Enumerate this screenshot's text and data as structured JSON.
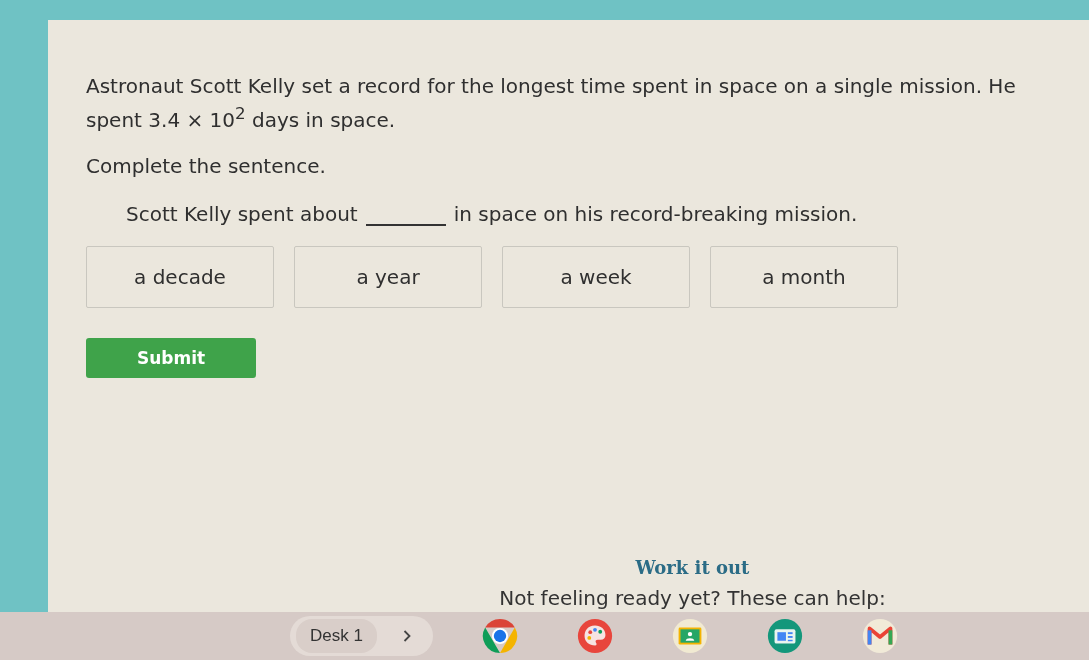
{
  "passage": "Astronaut Scott Kelly set a record for the longest time spent in space on a single mission. He spent 3.4 × 10$^{2}$ days in space.",
  "instruction": "Complete the sentence.",
  "sentence": {
    "before": "Scott Kelly spent about",
    "after": "in space on his record-breaking mission."
  },
  "choices": [
    {
      "label": "a decade",
      "selected": false
    },
    {
      "label": "a year",
      "selected": false
    },
    {
      "label": "a week",
      "selected": false
    },
    {
      "label": "a month",
      "selected": false
    }
  ],
  "submit_button": "Submit",
  "work_it_out": {
    "title": "Work it out",
    "prompt": "Not feeling ready yet? These can help:"
  },
  "taskbar": {
    "desk_label": "Desk 1",
    "apps": [
      {
        "kind": "browser"
      },
      {
        "kind": "palette"
      },
      {
        "kind": "classroom"
      },
      {
        "kind": "news"
      },
      {
        "kind": "mail"
      }
    ]
  }
}
